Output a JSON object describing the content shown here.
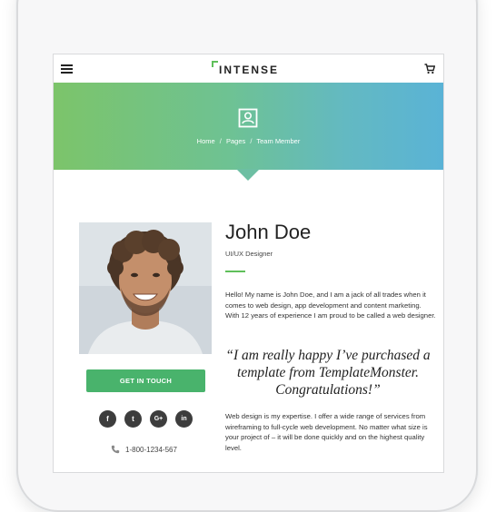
{
  "header": {
    "logo_text": "INTENSE",
    "menu_icon": "hamburger-menu-icon",
    "cart_icon": "cart-icon"
  },
  "hero": {
    "icon": "profile-card-icon",
    "breadcrumb": [
      "Home",
      "Pages",
      "Team Member"
    ],
    "separator": "/"
  },
  "member": {
    "name": "John Doe",
    "role": "UI/UX Designer",
    "bio": "Hello! My name is John Doe, and I am a jack of all trades when it comes to web design, app development and content marketing. With 12 years of experience I am proud to be called a web designer.",
    "quote": "“I am really happy I’ve purchased a template from TemplateMonster. Congratulations!”",
    "bio2": "Web design is my expertise. I offer a wide range of services from wireframing to full-cycle web development. No matter what size is your project of – it will be done quickly and on the highest quality level."
  },
  "contact": {
    "cta_label": "GET IN TOUCH",
    "socials": [
      {
        "icon": "facebook-icon",
        "glyph": "f"
      },
      {
        "icon": "twitter-icon",
        "glyph": "t"
      },
      {
        "icon": "google-plus-icon",
        "glyph": "G+"
      },
      {
        "icon": "linkedin-icon",
        "glyph": "in"
      }
    ],
    "phone": "1-800-1234-567"
  },
  "colors": {
    "accent": "#49b36c",
    "gradient_start": "#7cc46a",
    "gradient_end": "#5ab3d6",
    "social_bg": "#3d3d3d"
  }
}
